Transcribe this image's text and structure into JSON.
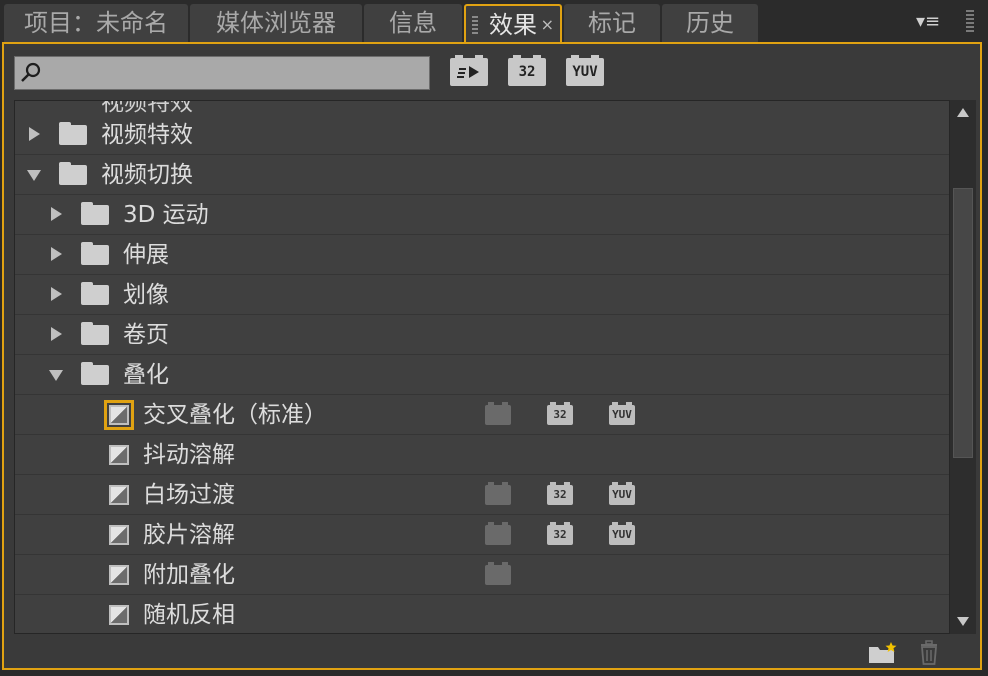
{
  "tabs": [
    {
      "label": "项目：未命名"
    },
    {
      "label": "媒体浏览器"
    },
    {
      "label": "信息"
    },
    {
      "label": "效果",
      "close": "×"
    },
    {
      "label": "标记"
    },
    {
      "label": "历史"
    }
  ],
  "panel_menu_icon": "panel-menu-icon",
  "search": {
    "value": "",
    "placeholder": ""
  },
  "filters": {
    "accelerated_label": "",
    "bit32_label": "32",
    "yuv_label": "YUV"
  },
  "tree": {
    "partial_top": "视频特效",
    "items": [
      {
        "label": "视频特效"
      },
      {
        "label": "视频切换"
      },
      {
        "label": "3D 运动"
      },
      {
        "label": "伸展"
      },
      {
        "label": "划像"
      },
      {
        "label": "卷页"
      },
      {
        "label": "叠化"
      },
      {
        "label": "交叉叠化（标准）"
      },
      {
        "label": "抖动溶解"
      },
      {
        "label": "白场过渡"
      },
      {
        "label": "胶片溶解"
      },
      {
        "label": "附加叠化"
      },
      {
        "label": "随机反相"
      }
    ]
  },
  "badges": {
    "b32": "32",
    "yuv": "YUV"
  },
  "colors": {
    "accent": "#e0a212",
    "panel_bg": "#3a3a3a",
    "list_bg": "#404040"
  }
}
